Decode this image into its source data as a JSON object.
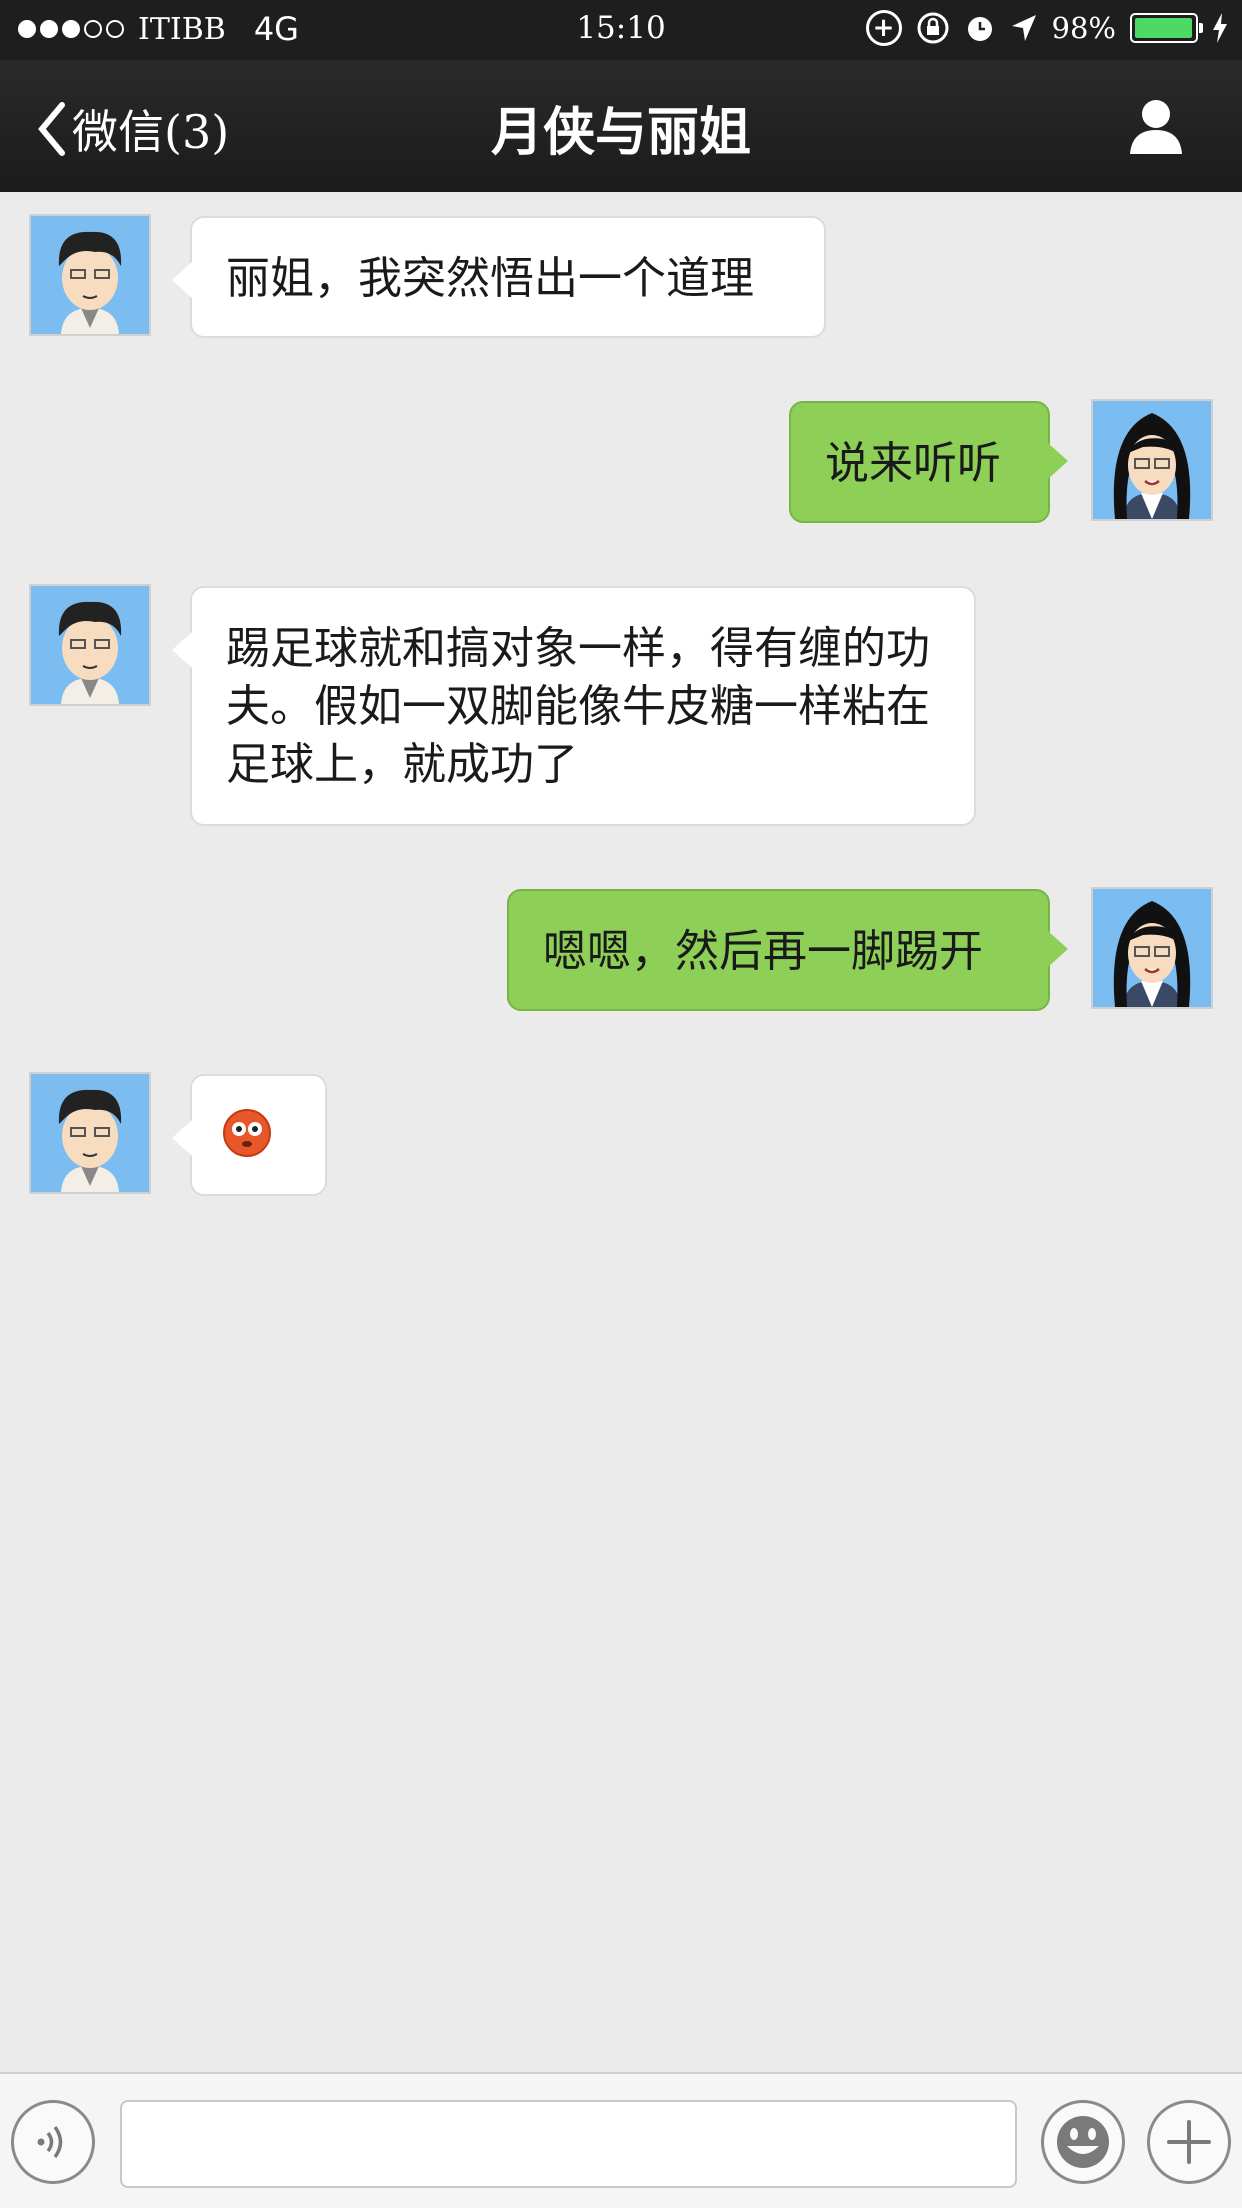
{
  "status_bar": {
    "carrier": "ITIBB",
    "network": "4G",
    "time": "15:10",
    "battery_percent": "98%",
    "signal_bars_filled": 3,
    "signal_bars_total": 5
  },
  "nav": {
    "back_label": "微信(3)",
    "title": "月侠与丽姐"
  },
  "messages": [
    {
      "side": "in",
      "text": "丽姐，我突然悟出一个道理"
    },
    {
      "side": "out",
      "text": "说来听听"
    },
    {
      "side": "in",
      "text": "踢足球就和搞对象一样，得有缠的功夫。假如一双脚能像牛皮糖一样粘在足球上，就成功了"
    },
    {
      "side": "out",
      "text": "嗯嗯，然后再一脚踢开"
    },
    {
      "side": "in",
      "text": "",
      "emoji": "flushed-face"
    }
  ],
  "input": {
    "value": "",
    "placeholder": ""
  },
  "colors": {
    "bar_bg": "#1e1e1e",
    "chat_bg": "#ebebeb",
    "bubble_out": "#8ed057",
    "bubble_in": "#ffffff",
    "battery": "#4cd964"
  }
}
